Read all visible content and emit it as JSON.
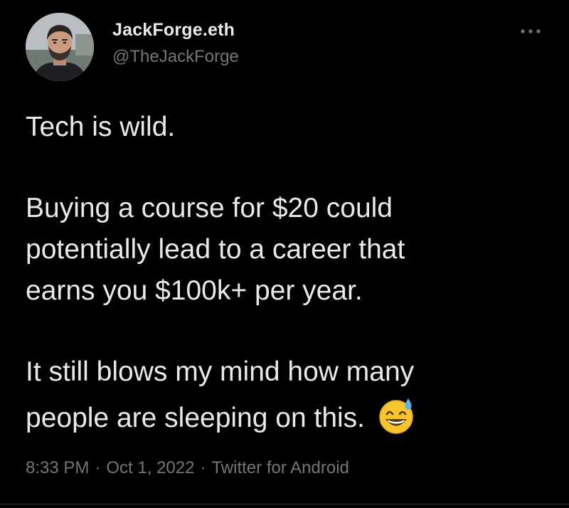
{
  "author": {
    "display_name": "JackForge.eth",
    "handle": "@TheJackForge",
    "avatar_icon": "profile-photo"
  },
  "more_icon": "more-options-icon",
  "tweet": {
    "line1": "Tech is wild.",
    "line2": "Buying a course for $20 could",
    "line3": "potentially lead to a career that",
    "line4": "earns you $100k+ per year.",
    "line5": "It still blows my mind how many",
    "line6": "people are sleeping on this.",
    "emoji": "grinning-face-with-sweat"
  },
  "meta": {
    "time": "8:33 PM",
    "separator": "·",
    "date": "Oct 1, 2022",
    "source": "Twitter for Android"
  },
  "colors": {
    "background": "#000000",
    "primary_text": "#e7e9ea",
    "secondary_text": "#71767b"
  }
}
